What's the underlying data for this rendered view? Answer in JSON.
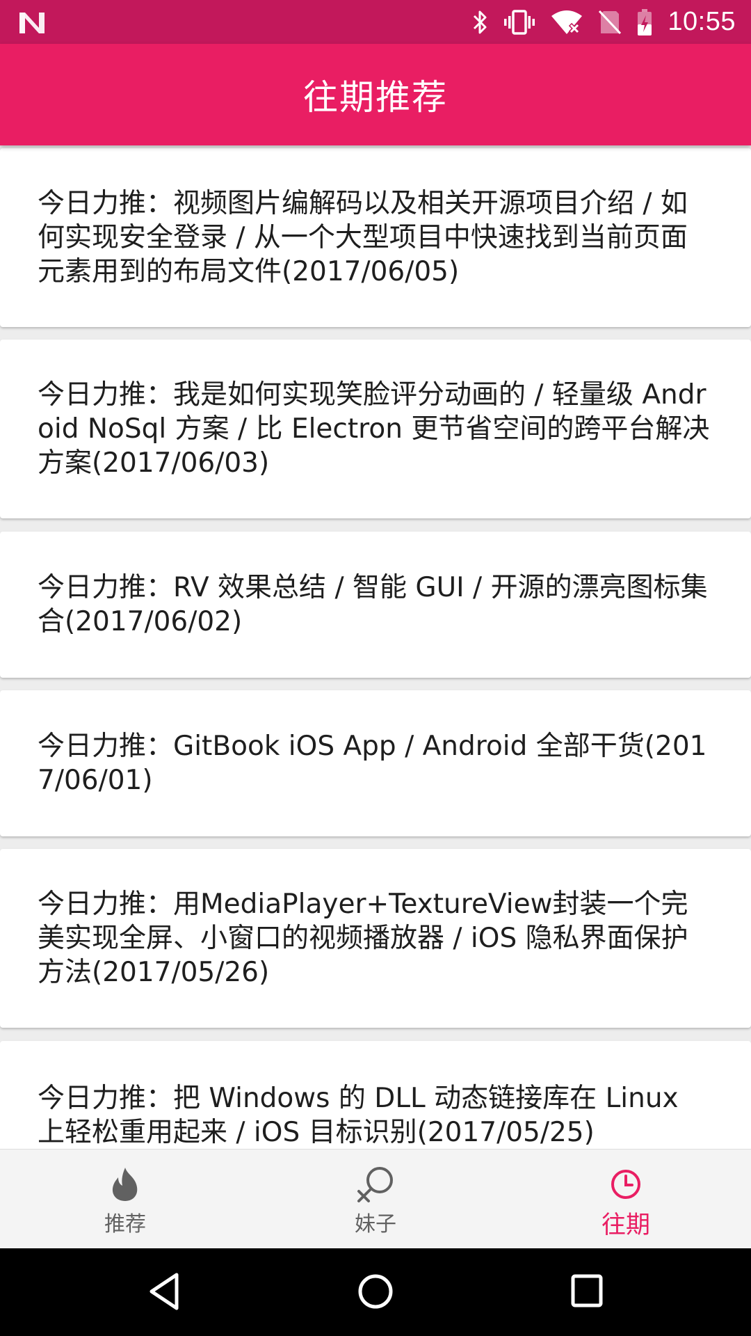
{
  "status_bar": {
    "time": "10:55",
    "icons": [
      "n-logo-icon",
      "bluetooth-icon",
      "vibrate-icon",
      "wifi-off-icon",
      "no-sim-icon",
      "battery-icon"
    ]
  },
  "app_bar": {
    "title": "往期推荐"
  },
  "list": {
    "items": [
      {
        "text": "今日力推：视频图片编解码以及相关开源项目介绍 / 如何实现安全登录 / 从一个大型项目中快速找到当前页面元素用到的布局文件(2017/06/05)"
      },
      {
        "text": "今日力推：我是如何实现笑脸评分动画的 / 轻量级 Android NoSql 方案 / 比 Electron 更节省空间的跨平台解决方案(2017/06/03)"
      },
      {
        "text": "今日力推：RV 效果总结 / 智能 GUI / 开源的漂亮图标集合(2017/06/02)"
      },
      {
        "text": "今日力推：GitBook iOS App / Android 全部干货(2017/06/01)"
      },
      {
        "text": "今日力推：用MediaPlayer+TextureView封装一个完美实现全屏、小窗口的视频播放器 / iOS 隐私界面保护方法(2017/05/26)"
      },
      {
        "text": "今日力推：把 Windows 的 DLL 动态链接库在 Linux 上轻松重用起来 / iOS 目标识别(2017/05/25)"
      }
    ]
  },
  "bottom_nav": {
    "items": [
      {
        "label": "推荐",
        "icon": "flame-icon",
        "active": false
      },
      {
        "label": "妹子",
        "icon": "female-symbol-icon",
        "active": false
      },
      {
        "label": "往期",
        "icon": "clock-icon",
        "active": true
      }
    ]
  },
  "colors": {
    "status_bar": "#c2185b",
    "primary": "#e91e63",
    "inactive": "#616161"
  },
  "system_nav": {
    "icons": [
      "back-icon",
      "home-icon",
      "recents-icon"
    ]
  }
}
